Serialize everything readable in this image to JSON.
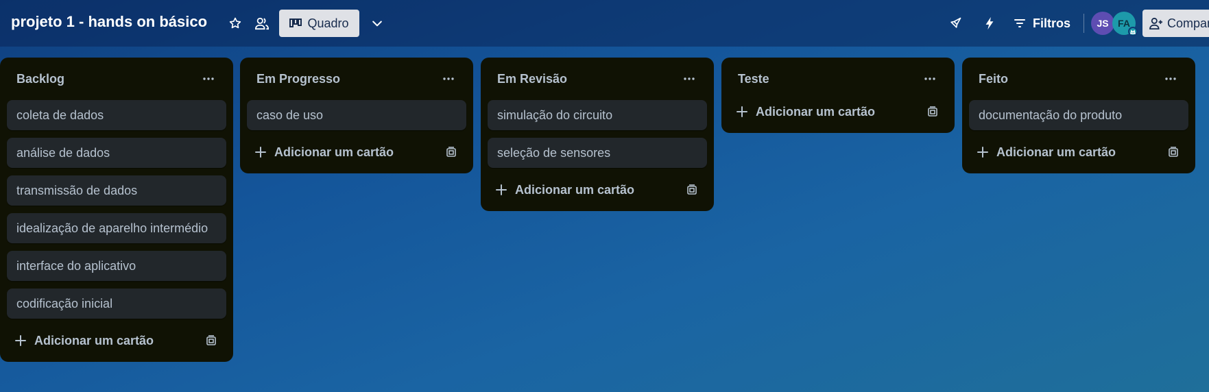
{
  "header": {
    "board_title": "projeto 1 - hands on básico",
    "view_label": "Quadro",
    "filter_label": "Filtros",
    "share_label": "Compar",
    "avatars": [
      {
        "initials": "JS",
        "color": "#5e4db2"
      },
      {
        "initials": "FA",
        "color": "#1d9aaa"
      }
    ]
  },
  "add_card_label": "Adicionar um cartão",
  "lists": [
    {
      "title": "Backlog",
      "cards": [
        "coleta de dados",
        "análise de dados",
        "transmissão de dados",
        "idealização de aparelho intermédio",
        "interface do aplicativo",
        "codificação inicial"
      ]
    },
    {
      "title": "Em Progresso",
      "cards": [
        "caso de uso"
      ]
    },
    {
      "title": "Em Revisão",
      "cards": [
        "simulação do circuito",
        "seleção de sensores"
      ]
    },
    {
      "title": "Teste",
      "cards": []
    },
    {
      "title": "Feito",
      "cards": [
        "documentação do produto"
      ]
    }
  ],
  "colors": {
    "list_bg": "#101204",
    "card_bg": "#22272b",
    "text": "#b6c2cf",
    "header_button_bg": "#dfe1e6"
  }
}
